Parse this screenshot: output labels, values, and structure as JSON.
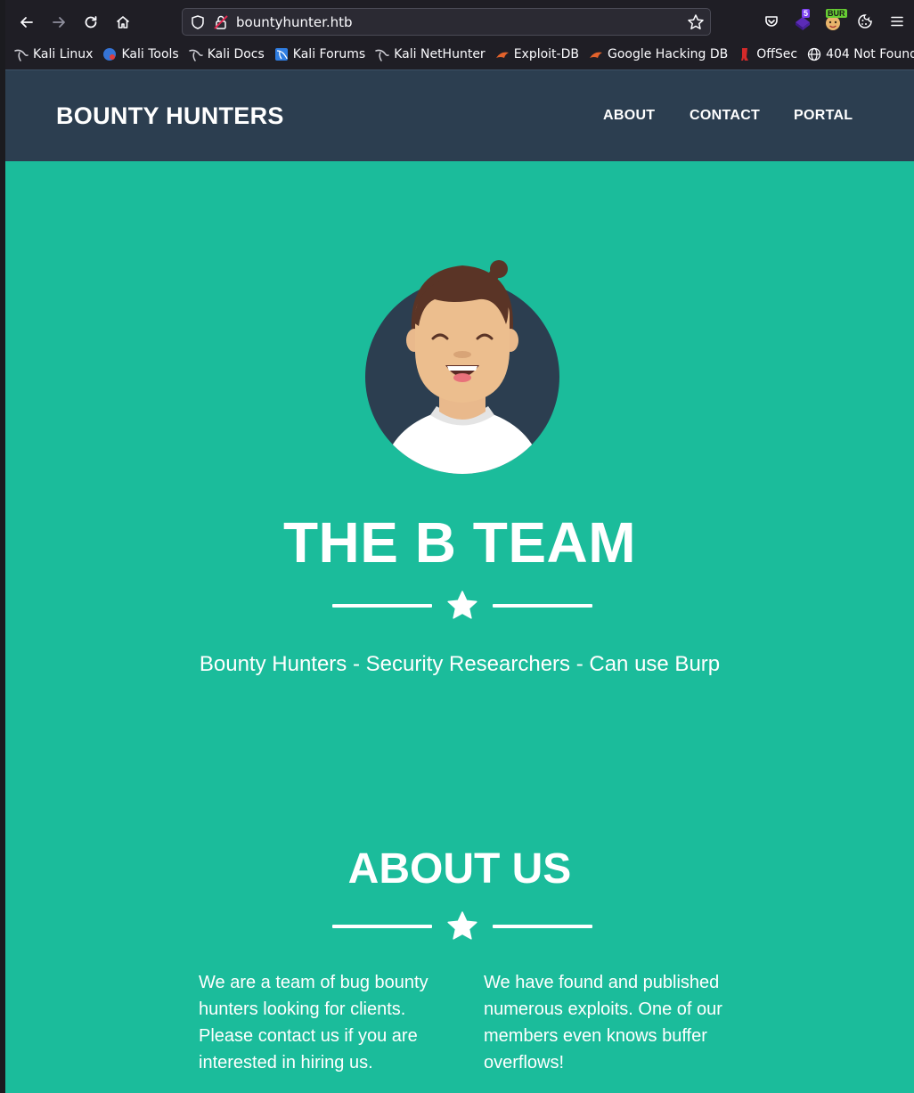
{
  "browser": {
    "url": "bountyhunter.htb",
    "extension_badge": "5",
    "burp_badge": "BUR",
    "bookmarks": [
      {
        "label": "Kali Linux",
        "icon": "kali-dragon-icon"
      },
      {
        "label": "Kali Tools",
        "icon": "kali-tools-icon"
      },
      {
        "label": "Kali Docs",
        "icon": "kali-dragon-icon"
      },
      {
        "label": "Kali Forums",
        "icon": "kali-forums-icon"
      },
      {
        "label": "Kali NetHunter",
        "icon": "kali-dragon-icon"
      },
      {
        "label": "Exploit-DB",
        "icon": "exploit-db-icon"
      },
      {
        "label": "Google Hacking DB",
        "icon": "exploit-db-icon"
      },
      {
        "label": "OffSec",
        "icon": "offsec-icon"
      },
      {
        "label": "404 Not Found",
        "icon": "globe-icon"
      }
    ]
  },
  "site": {
    "brand": "BOUNTY HUNTERS",
    "nav": {
      "about": "ABOUT",
      "contact": "CONTACT",
      "portal": "PORTAL"
    },
    "hero": {
      "title": "THE B TEAM",
      "subtitle": "Bounty Hunters - Security Researchers - Can use Burp"
    },
    "about": {
      "title": "ABOUT US",
      "col1": "We are a team of bug bounty hunters looking for clients. Please contact us if you are interested in hiring us.",
      "col2": "We have found and published numerous exploits. One of our members even knows buffer overflows!"
    }
  },
  "colors": {
    "primary": "#1bbc9b",
    "navbar": "#2c3e50",
    "chrome": "#1f1e25"
  }
}
